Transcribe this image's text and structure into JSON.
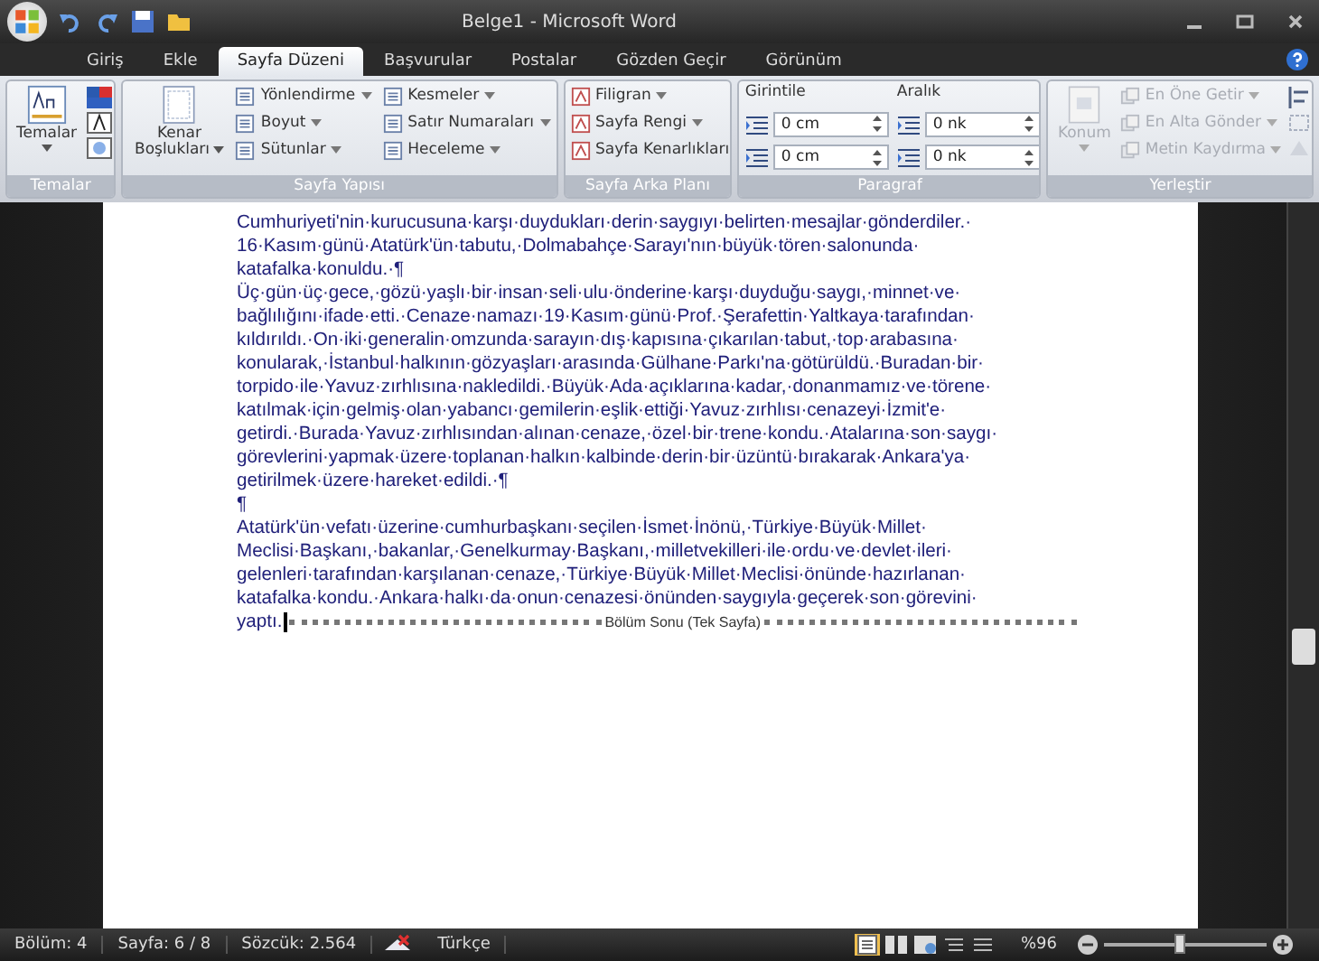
{
  "window": {
    "title": "Belge1 - Microsoft Word"
  },
  "tabs": [
    {
      "label": "Giriş",
      "selected": false
    },
    {
      "label": "Ekle",
      "selected": false
    },
    {
      "label": "Sayfa Düzeni",
      "selected": true
    },
    {
      "label": "Başvurular",
      "selected": false
    },
    {
      "label": "Postalar",
      "selected": false
    },
    {
      "label": "Gözden Geçir",
      "selected": false
    },
    {
      "label": "Görünüm",
      "selected": false
    }
  ],
  "ribbon": {
    "groups": [
      {
        "kind": "themes",
        "label": "Temalar",
        "big": "Temalar",
        "big_dropdown": true
      },
      {
        "kind": "setup",
        "label": "Sayfa Yapısı",
        "big": "Kenar Boşlukları",
        "big_dropdown": true,
        "items": [
          {
            "label": "Yönlendirme",
            "disabled": false,
            "dropdown": true
          },
          {
            "label": "Kesmeler",
            "disabled": false,
            "dropdown": true
          },
          {
            "label": "Boyut",
            "disabled": false,
            "dropdown": true
          },
          {
            "label": "Satır Numaraları",
            "disabled": false,
            "dropdown": true
          },
          {
            "label": "Sütunlar",
            "disabled": false,
            "dropdown": true
          },
          {
            "label": "Heceleme",
            "disabled": false,
            "dropdown": true
          }
        ]
      },
      {
        "kind": "background",
        "label": "Sayfa Arka Planı",
        "items": [
          {
            "label": "Filigran",
            "disabled": false,
            "dropdown": true
          },
          {
            "label": "Sayfa Rengi",
            "disabled": false,
            "dropdown": true
          },
          {
            "label": "Sayfa Kenarlıkları",
            "disabled": false,
            "dropdown": false
          }
        ]
      },
      {
        "kind": "paragraph",
        "label": "Paragraf",
        "indent_label": "Girintile",
        "spacing_label": "Aralık",
        "fields": [
          {
            "value": "0 cm"
          },
          {
            "value": "0 nk"
          },
          {
            "value": "0 cm"
          },
          {
            "value": "0 nk"
          }
        ]
      },
      {
        "kind": "arrange",
        "label": "Yerleştir",
        "big": "Konum",
        "big_disabled": true,
        "big_dropdown": true,
        "items": [
          {
            "label": "En Öne Getir",
            "disabled": true,
            "dropdown": true
          },
          {
            "label": "En Alta Gönder",
            "disabled": true,
            "dropdown": true
          },
          {
            "label": "Metin Kaydırma",
            "disabled": true,
            "dropdown": true
          }
        ]
      }
    ]
  },
  "document": {
    "paragraphs": [
      {
        "lines": [
          "Cumhuriyeti'nin·kurucusuna·karşı·duydukları·derin·saygıyı·belirten·mesajlar·gönderdiler.·",
          "16·Kasım·günü·Atatürk'ün·tabutu,·Dolmabahçe·Sarayı'nın·büyük·tören·salonunda·",
          "katafalka·konuldu.·¶"
        ]
      },
      {
        "lines": [
          "Üç·gün·üç·gece,·gözü·yaşlı·bir·insan·seli·ulu·önderine·karşı·duyduğu·saygı,·minnet·ve·",
          "bağlılığını·ifade·etti.·Cenaze·namazı·19·Kasım·günü·Prof.·Şerafettin·Yaltkaya·tarafından·",
          "kıldırıldı.·On·iki·generalin·omzunda·sarayın·dış·kapısına·çıkarılan·tabut,·top·arabasına·",
          "konularak,·İstanbul·halkının·gözyaşları·arasında·Gülhane·Parkı'na·götürüldü.·Buradan·bir·",
          "torpido·ile·Yavuz·zırhlısına·nakledildi.·Büyük·Ada·açıklarına·kadar,·donanmamız·ve·törene·",
          "katılmak·için·gelmiş·olan·yabancı·gemilerin·eşlik·ettiği·Yavuz·zırhlısı·cenazeyi·İzmit'e·",
          "getirdi.·Burada·Yavuz·zırhlısından·alınan·cenaze,·özel·bir·trene·kondu.·Atalarına·son·saygı·",
          "görevlerini·yapmak·üzere·toplanan·halkın·kalbinde·derin·bir·üzüntü·bırakarak·Ankara'ya·",
          "getirilmek·üzere·hareket·edildi.·¶"
        ]
      },
      {
        "lines": [
          "¶"
        ]
      },
      {
        "lines": [
          "Atatürk'ün·vefatı·üzerine·cumhurbaşkanı·seçilen·İsmet·İnönü,·Türkiye·Büyük·Millet·",
          "Meclisi·Başkanı,·bakanlar,·Genelkurmay·Başkanı,·milletvekilleri·ile·ordu·ve·devlet·ileri·",
          "gelenleri·tarafından·karşılanan·cenaze,·Türkiye·Büyük·Millet·Meclisi·önünde·hazırlanan·",
          "katafalka·kondu.·Ankara·halkı·da·onun·cenazesi·önünden·saygıyla·geçerek·son·görevini·"
        ]
      }
    ],
    "last_line": "yaptı.",
    "section_break": "Bölüm Sonu (Tek Sayfa)"
  },
  "status_bar": {
    "items": [
      "Bölüm: 4",
      "Sayfa: 6 / 8",
      "Sözcük: 2.564"
    ],
    "language": "Türkçe",
    "zoom": "%96",
    "zoom_slider": {
      "level": 0.47
    }
  }
}
